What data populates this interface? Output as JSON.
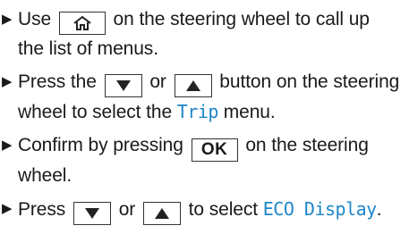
{
  "steps": [
    {
      "before": "Use",
      "key": "home-icon",
      "after": "on the steering wheel to call up the list of menus."
    },
    {
      "before": "Press the",
      "key1": "down-arrow-icon",
      "mid": "or",
      "key2": "up-arrow-icon",
      "after1": "button on the steering wheel to select the",
      "term": "Trip",
      "after2": "menu."
    },
    {
      "before": "Confirm by pressing",
      "key_label": "OK",
      "after": "on the steering wheel."
    },
    {
      "before": "Press",
      "key1": "down-arrow-icon",
      "mid": "or",
      "key2": "up-arrow-icon",
      "after": "to select",
      "term": "ECO Display",
      "end": "."
    }
  ],
  "colors": {
    "term": "#1f86c9",
    "text": "#1a1a1a"
  }
}
